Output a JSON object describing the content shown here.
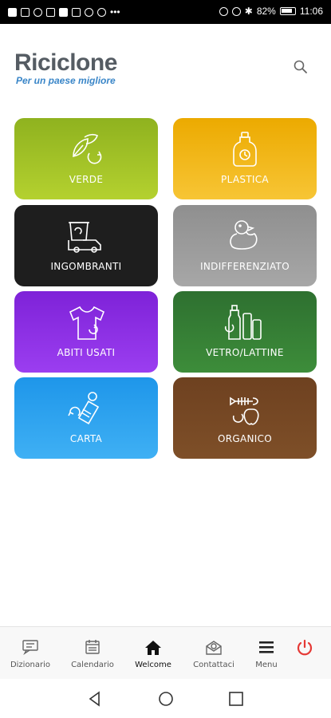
{
  "status_bar": {
    "battery": "82%",
    "time": "11:06"
  },
  "header": {
    "title": "Riciclone",
    "subtitle": "Per un paese migliore",
    "search_icon": "search-icon"
  },
  "categories": [
    {
      "label": "VERDE",
      "icon": "leaves-recycle-icon",
      "color": "#8fb21f"
    },
    {
      "label": "PLASTICA",
      "icon": "plastic-bottle-icon",
      "color": "#f0ab00"
    },
    {
      "label": "INGOMBRANTI",
      "icon": "truck-bin-icon",
      "color": "#1c1c1c"
    },
    {
      "label": "INDIFFERENZIATO",
      "icon": "rubber-duck-icon",
      "color": "#9a9a9a"
    },
    {
      "label": "ABITI USATI",
      "icon": "tshirt-recycle-icon",
      "color": "#8a2be2"
    },
    {
      "label": "VETRO/LATTINE",
      "icon": "bottles-cans-icon",
      "color": "#2e7d32"
    },
    {
      "label": "CARTA",
      "icon": "paper-recycle-icon",
      "color": "#2196f3"
    },
    {
      "label": "ORGANICO",
      "icon": "fish-apple-icon",
      "color": "#7a4a22"
    }
  ],
  "bottom_nav": [
    {
      "label": "Dizionario",
      "icon": "dictionary-icon"
    },
    {
      "label": "Calendario",
      "icon": "calendar-icon"
    },
    {
      "label": "Welcome",
      "icon": "home-icon"
    },
    {
      "label": "Contattaci",
      "icon": "contact-icon"
    },
    {
      "label": "Menu",
      "icon": "hamburger-icon"
    },
    {
      "label": "",
      "icon": "power-icon",
      "color": "#e53935"
    }
  ]
}
